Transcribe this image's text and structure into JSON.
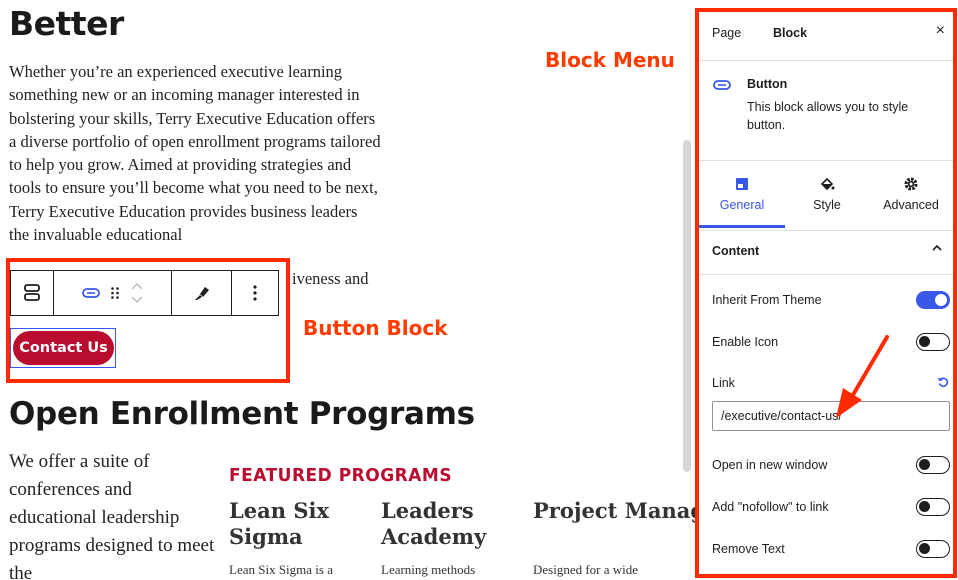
{
  "editor": {
    "heading_better": "Better",
    "paragraph_intro": "Whether you’re an experienced executive learning something new or an incoming manager interested in bolstering your skills, Terry Executive Education offers a diverse portfolio of open enrollment programs tailored to help you grow. Aimed at providing strategies and tools to ensure you’ll become what you need to be next, Terry Executive Education provides business leaders the invaluable educational",
    "paragraph_tail": "iveness and",
    "contact_button_label": "Contact Us",
    "heading_open_enrollment": "Open Enrollment Programs",
    "paragraph_offer": "We offer a suite of conferences and educational leadership programs designed to meet the",
    "featured_heading": "FEATURED PROGRAMS",
    "programs": [
      {
        "title": "Lean Six Sigma",
        "desc": "Lean Six Sigma is a"
      },
      {
        "title": "Leaders Academy",
        "desc": "Learning methods"
      },
      {
        "title": "Project Management",
        "desc": "Designed for a wide"
      }
    ]
  },
  "annotations": {
    "block_menu": "Block Menu",
    "button_block": "Button Block",
    "color": "#ff3b00"
  },
  "block_toolbar": {
    "icons": [
      "parent-block-icon",
      "button-icon",
      "drag-handle-icon",
      "move-up-down-icon",
      "style-brush-icon",
      "more-options-icon"
    ]
  },
  "sidebar": {
    "tabs": [
      "Page",
      "Block"
    ],
    "active_tab": "Block",
    "close_label": "×",
    "block_card": {
      "title": "Button",
      "description": "This block allows you to style button."
    },
    "subtabs": [
      {
        "label": "General",
        "icon": "layout-icon",
        "active": true
      },
      {
        "label": "Style",
        "icon": "paint-bucket-icon",
        "active": false
      },
      {
        "label": "Advanced",
        "icon": "gear-icon",
        "active": false
      }
    ],
    "section_title": "Content",
    "settings": {
      "inherit_from_theme": {
        "label": "Inherit From Theme",
        "enabled": true
      },
      "enable_icon": {
        "label": "Enable Icon",
        "enabled": false
      },
      "link_label": "Link",
      "link_value": "/executive/contact-us/",
      "open_in_new_window": {
        "label": "Open in new window",
        "enabled": false
      },
      "nofollow": {
        "label": "Add \"nofollow\" to link",
        "enabled": false
      },
      "remove_text": {
        "label": "Remove Text",
        "enabled": false
      }
    },
    "accent_color": "#3858e9",
    "brand_color": "#ba0c2f"
  }
}
